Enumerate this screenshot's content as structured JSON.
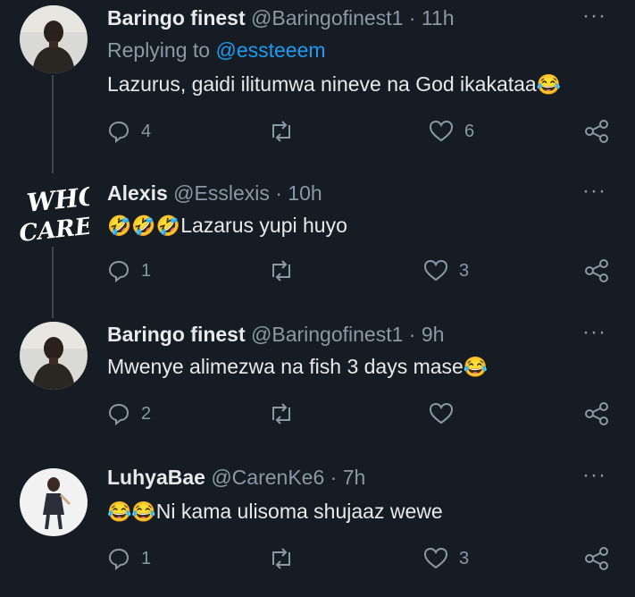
{
  "tweets": [
    {
      "name": "Baringo finest",
      "handle": "@Baringofinest1",
      "time": "· 11h",
      "replying_prefix": "Replying to ",
      "replying_to": "@essteeem",
      "text": "Lazurus,  gaidi ilitumwa nineve na God ikakataa",
      "emoji": "😂",
      "replies": "4",
      "retweets": "",
      "likes": "6",
      "avatar_icon": "person-avatar-dark"
    },
    {
      "name": "Alexis",
      "handle": "@Esslexis",
      "time": "· 10h",
      "emoji_prefix": "🤣🤣🤣",
      "text": "Lazarus yupi huyo",
      "replies": "1",
      "retweets": "",
      "likes": "3",
      "avatar_logo_lines": [
        "WHO",
        "CARES?"
      ]
    },
    {
      "name": "Baringo finest",
      "handle": "@Baringofinest1",
      "time": "· 9h",
      "text": "Mwenye alimezwa na fish 3 days mase",
      "emoji": "😂",
      "replies": "2",
      "retweets": "",
      "likes": "",
      "avatar_icon": "person-avatar-dark"
    },
    {
      "name": "LuhyaBae",
      "handle": "@CarenKe6",
      "time": "· 7h",
      "emoji_prefix": "😂😂",
      "text": "Ni kama ulisoma shujaaz wewe",
      "replies": "1",
      "retweets": "",
      "likes": "3",
      "avatar_icon": "person-avatar-light"
    }
  ],
  "more_label": "···",
  "colors": {
    "background": "#151c24",
    "text": "#e7e9ea",
    "secondary": "#8b98a5",
    "accent": "#1d9bf0"
  }
}
